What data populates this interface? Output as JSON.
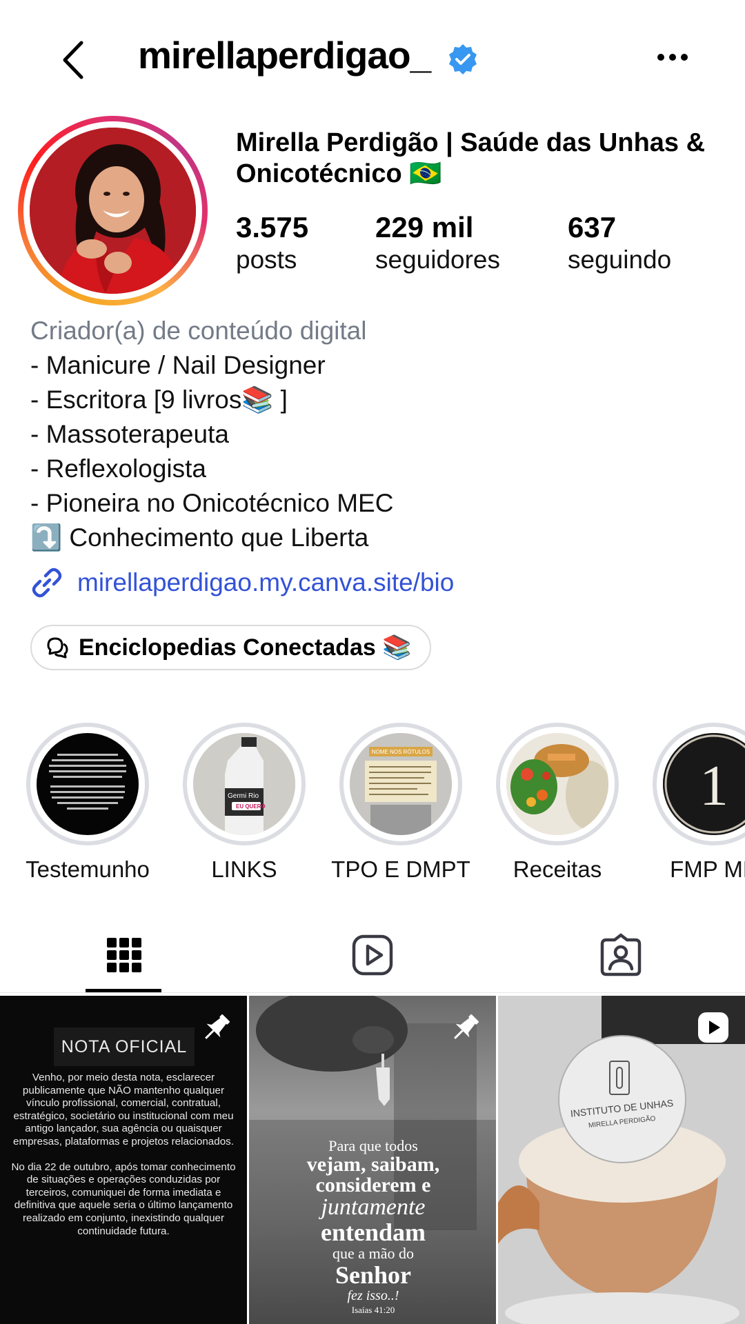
{
  "header": {
    "username": "mirellaperdigao_",
    "verified": true,
    "icons": {
      "back": "chevron-left-icon",
      "more": "more-horizontal-icon",
      "verified": "verified-badge-icon"
    }
  },
  "profile": {
    "display_name": "Mirella Perdigão | Saúde das Unhas & Onicotécnico 🇧🇷",
    "stats": [
      {
        "value": "3.575",
        "label": "posts"
      },
      {
        "value": "229 mil",
        "label": "seguidores"
      },
      {
        "value": "637",
        "label": "seguindo"
      }
    ],
    "category": "Criador(a) de conteúdo digital",
    "bio_lines": [
      "- Manicure / Nail Designer",
      "- Escritora [9 livros📚 ]",
      "- Massoterapeuta",
      "- Reflexologista",
      "- Pioneira no Onicotécnico MEC",
      "⤵️ Conhecimento que Liberta"
    ],
    "link": "mirellaperdigao.my.canva.site/bio",
    "channel": "Enciclopedias Conectadas 📚"
  },
  "highlights": [
    {
      "label": "Testemunho"
    },
    {
      "label": "LINKS"
    },
    {
      "label": "TPO E DMPT"
    },
    {
      "label": "Receitas"
    },
    {
      "label": "FMP ME"
    }
  ],
  "highlight_art": {
    "links_product": "Germi Rio",
    "links_badge": "EU QUERO",
    "tpo_banner": "NOME NOS RÓTULOS",
    "fmp_number": "1"
  },
  "tabs": [
    {
      "name": "posts",
      "icon": "grid-icon",
      "active": true
    },
    {
      "name": "reels",
      "icon": "reels-icon",
      "active": false
    },
    {
      "name": "tagged",
      "icon": "tagged-user-icon",
      "active": false
    }
  ],
  "posts": {
    "post1": {
      "title": "NOTA OFICIAL",
      "paragraph1": "Venho, por meio desta nota, esclarecer publicamente que NÃO mantenho qualquer vínculo profissional, comercial, contratual, estratégico, societário ou institucional com meu antigo lançador, sua agência ou quaisquer empresas, plataformas e projetos relacionados.",
      "paragraph2": "No dia 22 de outubro, após tomar conhecimento de situações e operações conduzidas por terceiros, comuniquei de forma imediata e definitiva que aquele seria o último lançamento realizado em conjunto, inexistindo qualquer continuidade futura.",
      "pinned": true
    },
    "post2": {
      "line1": "Para que todos",
      "line2": "vejam, saibam,",
      "line3": "considerem e",
      "line4": "juntamente",
      "line5": "entendam",
      "line6": "que a mão do",
      "line7": "Senhor",
      "line8": "fez isso..!",
      "ref": "Isaías 41:20",
      "pinned": true
    },
    "post3": {
      "brand_line1": "INSTITUTO DE UNHAS",
      "brand_line2": "MIRELLA PERDIGÃO",
      "is_reel": true
    }
  }
}
